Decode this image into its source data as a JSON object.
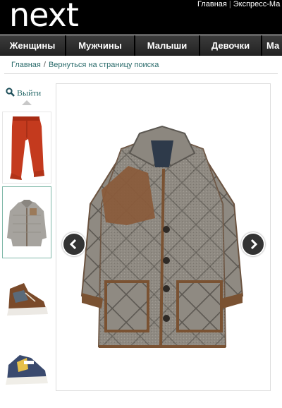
{
  "header": {
    "logo": "next",
    "top_links": [
      "Главная",
      "Экспресс-Ма"
    ]
  },
  "nav": {
    "items": [
      "Женщины",
      "Мужчины",
      "Малыши",
      "Девочки",
      "Ма"
    ]
  },
  "breadcrumb": {
    "home": "Главная",
    "separator": "/",
    "back": "Вернуться на страницу поиска"
  },
  "zoom": {
    "label": "Выйти",
    "icon": "magnifier-icon"
  },
  "thumbnails": [
    {
      "name": "red-trousers",
      "selected": false
    },
    {
      "name": "grey-quilted-jacket",
      "selected": true
    },
    {
      "name": "brown-high-top-sneaker",
      "selected": false
    },
    {
      "name": "navy-sneaker",
      "selected": false
    }
  ],
  "gallery": {
    "prev_icon": "chevron-left-icon",
    "next_icon": "chevron-right-icon"
  },
  "colors": {
    "header_bg": "#000000",
    "nav_bg": "#2b2b2b",
    "link": "#2a6b6b",
    "selected_border": "#7fb8a8"
  }
}
